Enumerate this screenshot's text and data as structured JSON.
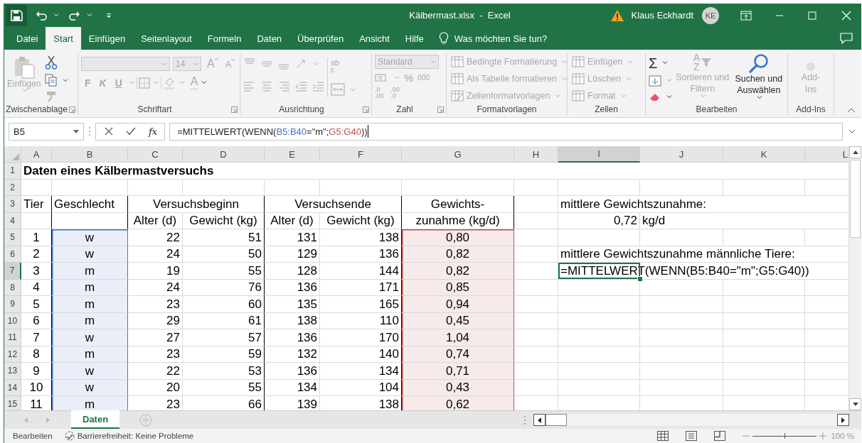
{
  "window": {
    "title": "Kälbermast.xlsx  -  Excel",
    "user": "Klaus Eckhardt",
    "avatar": "KE"
  },
  "menu_tabs": [
    {
      "label": "Datei",
      "selected": false
    },
    {
      "label": "Start",
      "selected": true
    },
    {
      "label": "Einfügen",
      "selected": false
    },
    {
      "label": "Seitenlayout",
      "selected": false
    },
    {
      "label": "Formeln",
      "selected": false
    },
    {
      "label": "Daten",
      "selected": false
    },
    {
      "label": "Überprüfen",
      "selected": false
    },
    {
      "label": "Ansicht",
      "selected": false
    },
    {
      "label": "Hilfe",
      "selected": false
    }
  ],
  "tell_me": {
    "placeholder": "Was möchten Sie tun?"
  },
  "ribbon": {
    "clipboard": {
      "label": "Zwischenablage",
      "paste": {
        "label": "Einfügen",
        "disabled": true
      }
    },
    "font": {
      "label": "Schriftart",
      "disabled": true,
      "size": "14",
      "grow": "A",
      "shrink": "A",
      "bold": "F",
      "italic": "K",
      "underline": "U",
      "text_color": "A"
    },
    "alignment": {
      "label": "Ausrichtung",
      "disabled": true,
      "wrap": [
        "ab",
        "c"
      ]
    },
    "number": {
      "label": "Zahl",
      "disabled": true,
      "format": "Standard",
      "percent": "%",
      "thousands": "000",
      "decimals": [
        {
          "top": ",0",
          "bottom": ",00"
        },
        {
          "top": ",00",
          "bottom": ",0"
        }
      ]
    },
    "styles": {
      "label": "Formatvorlagen",
      "items": [
        {
          "label": "Bedingte Formatierung",
          "disabled": true
        },
        {
          "label": "Als Tabelle formatieren",
          "disabled": true
        },
        {
          "label": "Zellenformatvorlagen",
          "disabled": true
        }
      ]
    },
    "cells": {
      "label": "Zellen",
      "items": [
        {
          "label": "Einfügen",
          "disabled": true
        },
        {
          "label": "Löschen",
          "disabled": true
        },
        {
          "label": "Format",
          "disabled": true
        }
      ]
    },
    "editing": {
      "label": "Bearbeiten",
      "sum": {
        "label": "Σ",
        "disabled": false
      },
      "sort": {
        "label": "Sortieren und Filtern",
        "glyphs": [
          "A",
          "Z"
        ],
        "disabled": true
      },
      "find": {
        "label": "Suchen und Auswählen",
        "disabled": false
      }
    },
    "addins": {
      "label": "Add-Ins",
      "button": {
        "label": "Add-Ins",
        "disabled": true
      }
    }
  },
  "formula_bar": {
    "name_box": "B5",
    "function_symbol": "fx",
    "formula": [
      {
        "kind": "text",
        "text": "=MITTELWERT(WENN("
      },
      {
        "kind": "reference",
        "text": "B5:B40"
      },
      {
        "kind": "text",
        "text": "=\"m\";"
      },
      {
        "kind": "reference",
        "text": "G5:G40"
      },
      {
        "kind": "text",
        "text": "))"
      }
    ]
  },
  "columns": [
    {
      "label": "A",
      "selected": false
    },
    {
      "label": "B",
      "selected": false,
      "color": "#4472c4"
    },
    {
      "label": "C",
      "selected": false
    },
    {
      "label": "D",
      "selected": false
    },
    {
      "label": "E",
      "selected": false
    },
    {
      "label": "F",
      "selected": false
    },
    {
      "label": "G",
      "selected": false,
      "color": "#c0504d"
    },
    {
      "label": "H",
      "selected": false
    },
    {
      "label": "I",
      "selected": true
    },
    {
      "label": "J",
      "selected": false
    },
    {
      "label": "K",
      "selected": false
    },
    {
      "label": "L",
      "selected": false
    }
  ],
  "rows": [
    {
      "number": "1",
      "selected": false,
      "cells": [
        "Daten eines Kälbermastversuchs"
      ]
    },
    {
      "number": "2",
      "selected": false
    },
    {
      "number": "3",
      "selected": false,
      "cells": [
        "Tier",
        "Geschlecht",
        "Versuchsbeginn",
        null,
        "Versuchsende",
        null,
        "Gewichts-",
        null,
        "mittlere Gewichtszunahme:"
      ]
    },
    {
      "number": "4",
      "selected": false,
      "cells": [
        null,
        null,
        "Alter (d)",
        "Gewicht (kg)",
        "Alter (d)",
        "Gewicht (kg)",
        "zunahme (kg/d)",
        null,
        "0,72",
        "kg/d"
      ]
    },
    {
      "number": "5",
      "selected": false,
      "cells": [
        "1",
        "w",
        "22",
        "51",
        "131",
        "138",
        "0,80"
      ]
    },
    {
      "number": "6",
      "selected": false,
      "cells": [
        "2",
        "w",
        "24",
        "50",
        "129",
        "136",
        "0,82",
        null,
        "mittlere Gewichtszunahme männliche Tiere:"
      ]
    },
    {
      "number": "7",
      "selected": true,
      "cells": [
        "3",
        "m",
        "19",
        "55",
        "128",
        "144",
        "0,82",
        null,
        "=MITTELWERT(WENN(B5:B40=\"m\";G5:G40))"
      ]
    },
    {
      "number": "8",
      "selected": false,
      "cells": [
        "4",
        "m",
        "24",
        "76",
        "136",
        "171",
        "0,85"
      ]
    },
    {
      "number": "9",
      "selected": false,
      "cells": [
        "5",
        "m",
        "23",
        "60",
        "135",
        "165",
        "0,94"
      ]
    },
    {
      "number": "10",
      "selected": false,
      "cells": [
        "6",
        "m",
        "29",
        "61",
        "138",
        "110",
        "0,45"
      ]
    },
    {
      "number": "11",
      "selected": false,
      "cells": [
        "7",
        "w",
        "27",
        "57",
        "136",
        "170",
        "1,04"
      ]
    },
    {
      "number": "12",
      "selected": false,
      "cells": [
        "8",
        "m",
        "23",
        "59",
        "132",
        "140",
        "0,74"
      ]
    },
    {
      "number": "13",
      "selected": false,
      "cells": [
        "9",
        "w",
        "22",
        "53",
        "136",
        "134",
        "0,71"
      ]
    },
    {
      "number": "14",
      "selected": false,
      "cells": [
        "10",
        "w",
        "20",
        "55",
        "134",
        "104",
        "0,43"
      ]
    },
    {
      "number": "15",
      "selected": false,
      "cells": [
        "11",
        "m",
        "23",
        "66",
        "139",
        "138",
        "0,62"
      ]
    }
  ],
  "sheet_tabs": [
    {
      "label": "Daten",
      "selected": true
    }
  ],
  "status_bar": {
    "mode": "Bearbeiten",
    "accessibility": "Barrierefreiheit: Keine Probleme",
    "zoom_slider": {
      "level": 0.5
    },
    "zoom": "100 %"
  }
}
